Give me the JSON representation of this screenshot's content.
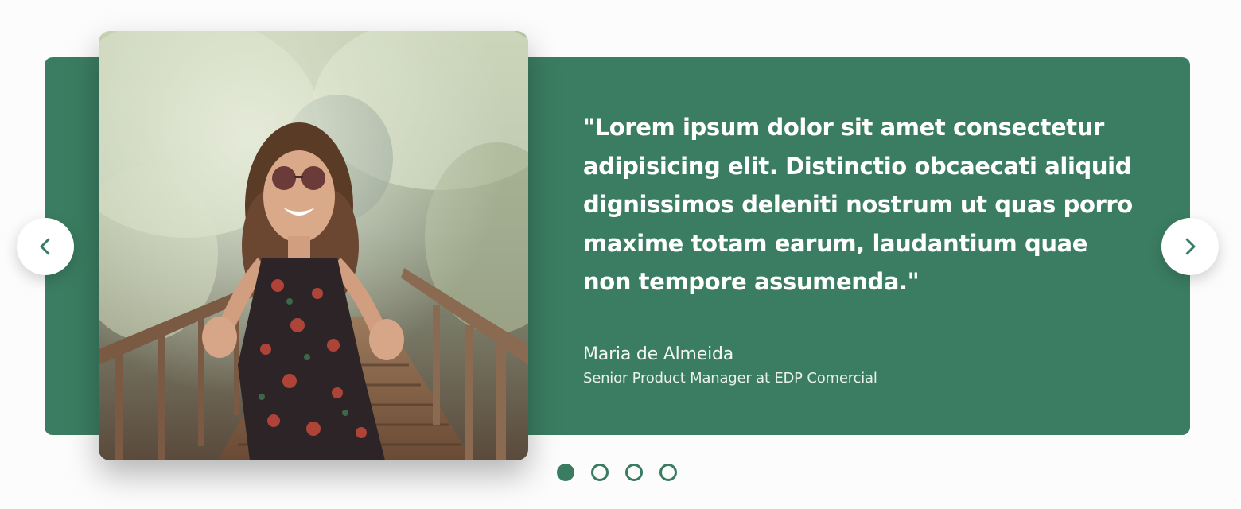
{
  "colors": {
    "accent": "#397c61",
    "card_background": "#3b7d62",
    "text_on_accent": "#ffffff"
  },
  "testimonial": {
    "quote": "\"Lorem ipsum dolor sit amet consectetur adipisicing elit. Distinctio obcaecati aliquid dignissimos deleniti nostrum ut quas porro maxime totam earum, laudantium quae non tempore assumenda.\"",
    "author_name": "Maria de Almeida",
    "author_role": "Senior Product Manager at EDP Comercial"
  },
  "navigation": {
    "prev_icon": "chevron-left-icon",
    "next_icon": "chevron-right-icon"
  },
  "pagination": {
    "total": 4,
    "active_index": 0
  }
}
